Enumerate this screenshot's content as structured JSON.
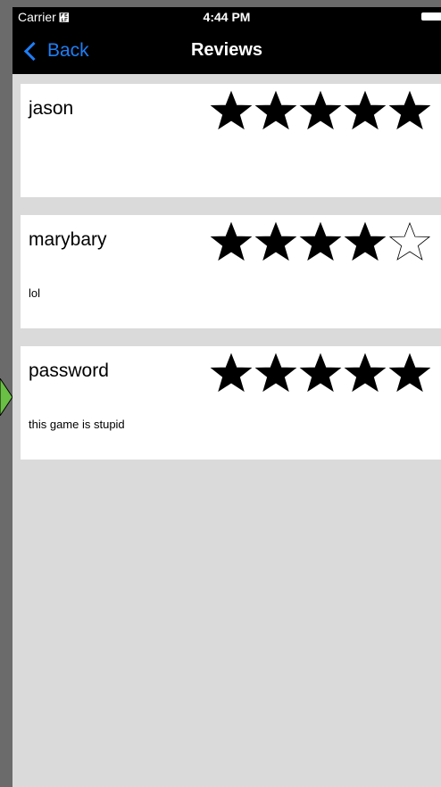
{
  "status_bar": {
    "carrier": "Carrier",
    "time": "4:44 PM",
    "wifi_icon": "wifi-icon",
    "battery_icon": "battery-icon"
  },
  "nav": {
    "back_label": "Back",
    "title": "Reviews"
  },
  "colors": {
    "accent": "#1e7ef5",
    "header_bg": "#000000",
    "screen_bg": "#dadada",
    "card_bg": "#ffffff",
    "pointer": "#6abf45"
  },
  "reviews": [
    {
      "name": "jason",
      "rating": 5,
      "max_rating": 5,
      "text": ""
    },
    {
      "name": "marybary",
      "rating": 4,
      "max_rating": 5,
      "text": "lol"
    },
    {
      "name": "password",
      "rating": 5,
      "max_rating": 5,
      "text": "this game is stupid"
    }
  ]
}
